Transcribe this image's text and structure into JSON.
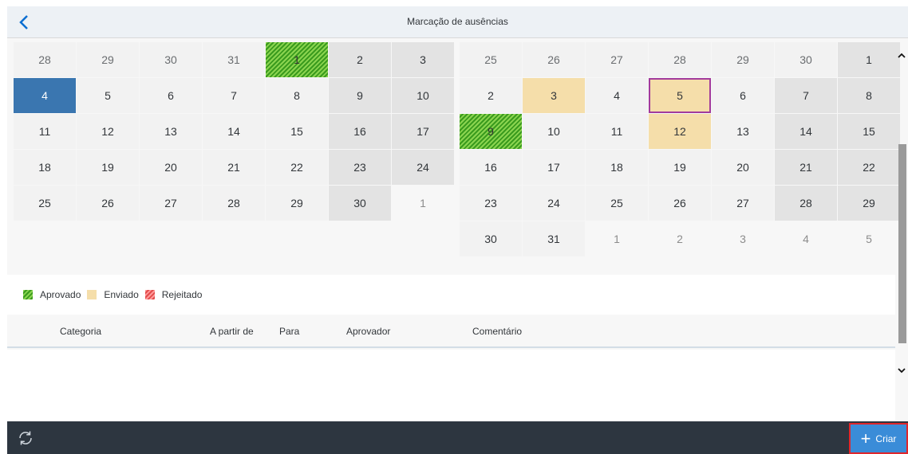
{
  "header": {
    "title": "Marcação de ausências"
  },
  "calendar": {
    "left": [
      {
        "d": "28",
        "s": "other-bg"
      },
      {
        "d": "29",
        "s": "other-bg"
      },
      {
        "d": "30",
        "s": "other-bg"
      },
      {
        "d": "31",
        "s": "other-bg"
      },
      {
        "d": "1",
        "s": "approved"
      },
      {
        "d": "2",
        "s": "weekend"
      },
      {
        "d": "3",
        "s": "weekend"
      },
      {
        "d": "4",
        "s": "selected"
      },
      {
        "d": "5",
        "s": ""
      },
      {
        "d": "6",
        "s": ""
      },
      {
        "d": "7",
        "s": ""
      },
      {
        "d": "8",
        "s": ""
      },
      {
        "d": "9",
        "s": "weekend"
      },
      {
        "d": "10",
        "s": "weekend"
      },
      {
        "d": "11",
        "s": ""
      },
      {
        "d": "12",
        "s": ""
      },
      {
        "d": "13",
        "s": ""
      },
      {
        "d": "14",
        "s": ""
      },
      {
        "d": "15",
        "s": ""
      },
      {
        "d": "16",
        "s": "weekend"
      },
      {
        "d": "17",
        "s": "weekend"
      },
      {
        "d": "18",
        "s": ""
      },
      {
        "d": "19",
        "s": ""
      },
      {
        "d": "20",
        "s": ""
      },
      {
        "d": "21",
        "s": ""
      },
      {
        "d": "22",
        "s": ""
      },
      {
        "d": "23",
        "s": "weekend"
      },
      {
        "d": "24",
        "s": "weekend"
      },
      {
        "d": "25",
        "s": ""
      },
      {
        "d": "26",
        "s": ""
      },
      {
        "d": "27",
        "s": ""
      },
      {
        "d": "28",
        "s": ""
      },
      {
        "d": "29",
        "s": ""
      },
      {
        "d": "30",
        "s": "weekend"
      },
      {
        "d": "1",
        "s": "other"
      }
    ],
    "right": [
      {
        "d": "25",
        "s": "other-bg"
      },
      {
        "d": "26",
        "s": "other-bg"
      },
      {
        "d": "27",
        "s": "other-bg"
      },
      {
        "d": "28",
        "s": "other-bg"
      },
      {
        "d": "29",
        "s": "other-bg"
      },
      {
        "d": "30",
        "s": "other-bg"
      },
      {
        "d": "1",
        "s": "weekend"
      },
      {
        "d": "2",
        "s": ""
      },
      {
        "d": "3",
        "s": "sent"
      },
      {
        "d": "4",
        "s": ""
      },
      {
        "d": "5",
        "s": "sent today"
      },
      {
        "d": "6",
        "s": ""
      },
      {
        "d": "7",
        "s": "weekend"
      },
      {
        "d": "8",
        "s": "weekend"
      },
      {
        "d": "9",
        "s": "approved"
      },
      {
        "d": "10",
        "s": ""
      },
      {
        "d": "11",
        "s": ""
      },
      {
        "d": "12",
        "s": "sent"
      },
      {
        "d": "13",
        "s": ""
      },
      {
        "d": "14",
        "s": "weekend"
      },
      {
        "d": "15",
        "s": "weekend"
      },
      {
        "d": "16",
        "s": ""
      },
      {
        "d": "17",
        "s": ""
      },
      {
        "d": "18",
        "s": ""
      },
      {
        "d": "19",
        "s": ""
      },
      {
        "d": "20",
        "s": ""
      },
      {
        "d": "21",
        "s": "weekend"
      },
      {
        "d": "22",
        "s": "weekend"
      },
      {
        "d": "23",
        "s": ""
      },
      {
        "d": "24",
        "s": ""
      },
      {
        "d": "25",
        "s": ""
      },
      {
        "d": "26",
        "s": ""
      },
      {
        "d": "27",
        "s": ""
      },
      {
        "d": "28",
        "s": "weekend"
      },
      {
        "d": "29",
        "s": "weekend"
      },
      {
        "d": "30",
        "s": ""
      },
      {
        "d": "31",
        "s": ""
      },
      {
        "d": "1",
        "s": "other"
      },
      {
        "d": "2",
        "s": "other"
      },
      {
        "d": "3",
        "s": "other"
      },
      {
        "d": "4",
        "s": "other"
      },
      {
        "d": "5",
        "s": "other"
      }
    ]
  },
  "legend": {
    "approved": "Aprovado",
    "sent": "Enviado",
    "rejected": "Rejeitado"
  },
  "table": {
    "columns": [
      "Categoria",
      "A partir de",
      "Para",
      "Aprovador",
      "Comentário"
    ]
  },
  "footer": {
    "create_label": "Criar"
  },
  "icons": {
    "back": "chevron-left-icon",
    "refresh": "refresh-icon",
    "create": "plus-icon",
    "scroll_up": "chevron-up-icon",
    "scroll_down": "chevron-down-icon"
  },
  "colors": {
    "selected": "#3a76b0",
    "sent": "#f5deaa",
    "approved": "#3a9b1e",
    "rejected": "#e34c4c",
    "footer": "#2d3640",
    "create_button": "#3a8cd8"
  }
}
